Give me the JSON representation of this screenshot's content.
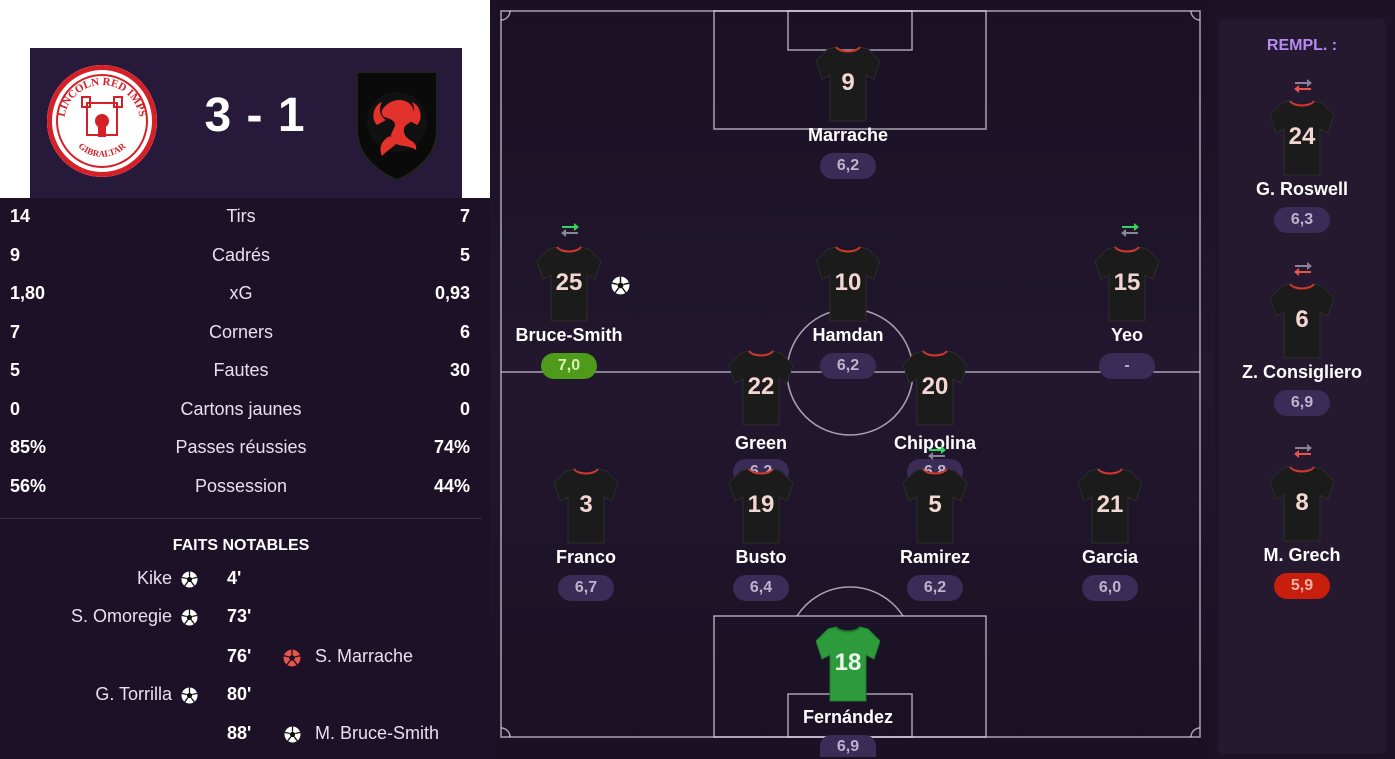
{
  "match": {
    "home_crest_text_top": "LINCOLN RED IMPS",
    "home_crest_text_bottom": "GIBRALTAR",
    "score": "3 - 1",
    "colors": {
      "home_red": "#d62027",
      "away_red": "#e3322b",
      "green_rating": "#4e9a1a",
      "red_rating": "#c71e0e",
      "accent_purple": "#b58cf0"
    }
  },
  "stats": [
    {
      "home": "14",
      "label": "Tirs",
      "away": "7"
    },
    {
      "home": "9",
      "label": "Cadrés",
      "away": "5"
    },
    {
      "home": "1,80",
      "label": "xG",
      "away": "0,93"
    },
    {
      "home": "7",
      "label": "Corners",
      "away": "6"
    },
    {
      "home": "5",
      "label": "Fautes",
      "away": "30"
    },
    {
      "home": "0",
      "label": "Cartons jaunes",
      "away": "0"
    },
    {
      "home": "85%",
      "label": "Passes réussies",
      "away": "74%"
    },
    {
      "home": "56%",
      "label": "Possession",
      "away": "44%"
    }
  ],
  "notable": {
    "title": "FAITS NOTABLES",
    "events": [
      {
        "side": "home",
        "player": "Kike",
        "minute": "4'",
        "icon": "goal-ball-icon"
      },
      {
        "side": "home",
        "player": "S. Omoregie",
        "minute": "73'",
        "icon": "goal-ball-icon"
      },
      {
        "side": "away",
        "player": "S. Marrache",
        "minute": "76'",
        "icon": "own-goal-ball-icon"
      },
      {
        "side": "home",
        "player": "G. Torrilla",
        "minute": "80'",
        "icon": "goal-ball-icon"
      },
      {
        "side": "away",
        "player": "M. Bruce-Smith",
        "minute": "88'",
        "icon": "goal-ball-icon"
      }
    ]
  },
  "lineup": [
    {
      "number": "9",
      "name": "Marrache",
      "rating": "6,2"
    },
    {
      "number": "25",
      "name": "Bruce-Smith",
      "rating": "7,0",
      "rating_state": "good",
      "subbed": "in",
      "scored": true
    },
    {
      "number": "10",
      "name": "Hamdan",
      "rating": "6,2"
    },
    {
      "number": "15",
      "name": "Yeo",
      "rating": "-",
      "subbed": "in"
    },
    {
      "number": "22",
      "name": "Green",
      "rating": "6,2"
    },
    {
      "number": "20",
      "name": "Chipolina",
      "rating": "6,8",
      "subbed": "in"
    },
    {
      "number": "3",
      "name": "Franco",
      "rating": "6,7"
    },
    {
      "number": "19",
      "name": "Busto",
      "rating": "6,4"
    },
    {
      "number": "5",
      "name": "Ramirez",
      "rating": "6,2"
    },
    {
      "number": "21",
      "name": "Garcia",
      "rating": "6,0"
    },
    {
      "number": "18",
      "name": "Fernández",
      "rating": "6,9",
      "goalkeeper": true
    }
  ],
  "subs": {
    "title": "REMPL. :",
    "players": [
      {
        "number": "24",
        "name": "G. Roswell",
        "rating": "6,3"
      },
      {
        "number": "6",
        "name": "Z. Consigliero",
        "rating": "6,9"
      },
      {
        "number": "8",
        "name": "M. Grech",
        "rating": "5,9",
        "rating_state": "bad"
      }
    ]
  }
}
